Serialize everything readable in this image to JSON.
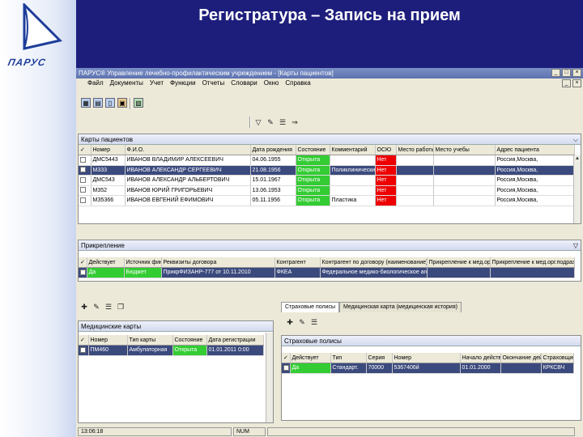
{
  "slide": {
    "title": "Регистратура – Запись на прием",
    "logo_text": "ПАРУС"
  },
  "window": {
    "title": "ПАРУС® Управление лечебно-профилактическим учреждением - [Карты пациентов]",
    "btn_min": "_",
    "btn_max": "□",
    "btn_close": "×"
  },
  "menu": [
    "Файл",
    "Документы",
    "Учет",
    "Функции",
    "Отчеты",
    "Словари",
    "Окно",
    "Справка"
  ],
  "patients": {
    "title": "Карты пациентов",
    "columns": [
      "Номер",
      "Ф.И.О.",
      "Дата рождения",
      "Состояние",
      "Комментарий",
      "ОСЮ",
      "Место работы",
      "Место учебы",
      "Адрес пациента"
    ],
    "rows": [
      {
        "num": "ДМС5443",
        "fio": "ИВАНОВ ВЛАДИМИР АЛЕКСЕЕВИЧ",
        "dob": "04.06.1955",
        "state": "Открыта",
        "comment": "",
        "osu": "Нет",
        "addr": "Россия,Москва,"
      },
      {
        "num": "М333",
        "fio": "ИВАНОВ АЛЕКСАНДР СЕРГЕЕВИЧ",
        "dob": "21.08.1956",
        "state": "Открыта",
        "comment": "Поликлинический ста",
        "osu": "Нет",
        "addr": "Россия,Москва,"
      },
      {
        "num": "ДМС543",
        "fio": "ИВАНОВ АЛЕКСАНДР АЛЬБЕРТОВИЧ",
        "dob": "15.01.1967",
        "state": "Открыта",
        "comment": "",
        "osu": "Нет",
        "addr": "Россия,Москва,"
      },
      {
        "num": "М352",
        "fio": "ИВАНОВ ЮРИЙ ГРИГОРЬЕВИЧ",
        "dob": "13.06.1953",
        "state": "Открыта",
        "comment": "",
        "osu": "Нет",
        "addr": "Россия,Москва,"
      },
      {
        "num": "МЗ5366",
        "fio": "ИВАНОВ ЕВГЕНИЙ ЕФИМОВИЧ",
        "dob": "05.11.1956",
        "state": "Открыта",
        "comment": "Пластика",
        "osu": "Нет",
        "addr": "Россия,Москва,"
      }
    ]
  },
  "attach": {
    "title": "Прикрепление",
    "columns": [
      "Действует",
      "Источник фин",
      "Реквизиты договора",
      "Контрагент",
      "Контрагент по договору (наименование)",
      "Прикрепление к мед.орг",
      "Прикрепление к мед.орг.подразд"
    ],
    "row": {
      "active": "Да",
      "source": "Бюджет",
      "contract": "ПрикрФИЗАНР-777 от 10.11.2010",
      "agent": "ФКЕА",
      "agent_name": "Федеральное медико-биологическое агентство"
    }
  },
  "medcards": {
    "title": "Медицинские карты",
    "columns": [
      "Номер",
      "Тип карты",
      "Состояние",
      "Дата регистрации"
    ],
    "row": {
      "num": "ПМ460",
      "type": "Амбулаторная",
      "state": "Открыта",
      "date": "01.01.2011 0:00"
    }
  },
  "tabs": [
    "Страховые полисы",
    "Медицинская карта (медицинская история)"
  ],
  "policies": {
    "title": "Страховые полисы",
    "columns": [
      "Действует",
      "Тип",
      "Серия",
      "Номер",
      "Начало действия",
      "Окончание действия",
      "Страховщик"
    ],
    "row": {
      "active": "Да",
      "type": "Стандарт.",
      "series": "70000",
      "num": "5367406й",
      "start": "01.01.2000",
      "end": "",
      "insurer": "КРКСВЧ"
    }
  },
  "status": {
    "time": "13:06:18",
    "num": "NUM"
  }
}
